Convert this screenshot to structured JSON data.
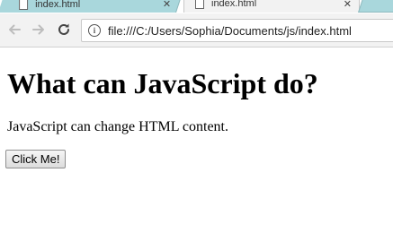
{
  "browser": {
    "tabs": [
      {
        "title": "index.html",
        "active": false
      },
      {
        "title": "index.html",
        "active": true
      }
    ],
    "close_glyph": "✕",
    "address_bar": {
      "url": "file:///C:/Users/Sophia/Documents/js/index.html",
      "icon": "info-icon"
    },
    "nav_icons": [
      "back-arrow-icon",
      "forward-arrow-icon",
      "reload-icon"
    ]
  },
  "page": {
    "heading": "What can JavaScript do?",
    "paragraph": "JavaScript can change HTML content.",
    "button_label": "Click Me!"
  }
}
